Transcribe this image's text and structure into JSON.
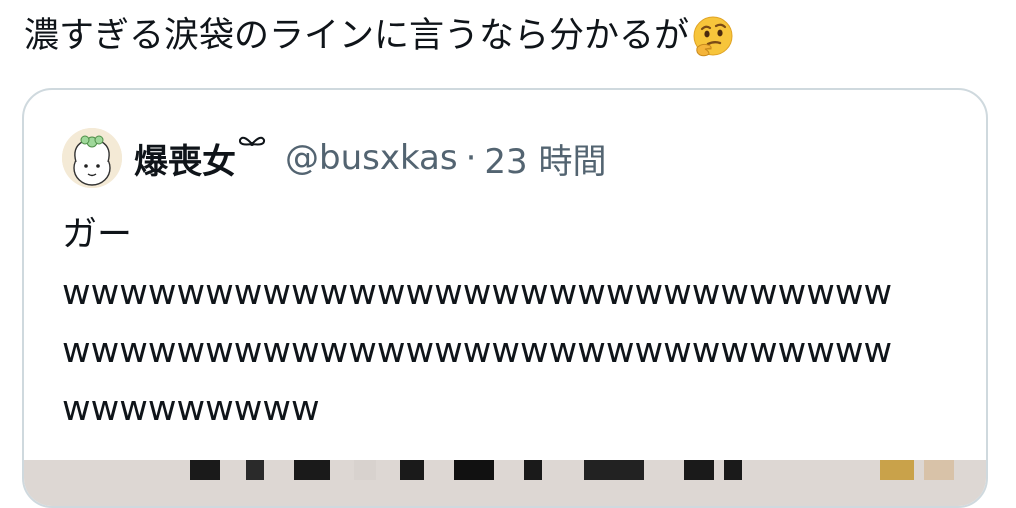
{
  "tweet": {
    "text": "濃すぎる涙袋のラインに言うなら分かるが",
    "emoji": "thinking-face"
  },
  "quote": {
    "display_name": "爆喪女",
    "handle": "@busxkas",
    "separator": "·",
    "time": "23 時間",
    "body_lines": [
      "ガー",
      "wwwwwwwwwwwwwwwwwwwwwwwwwwwww",
      "wwwwwwwwwwwwwwwwwwwwwwwwwwwww",
      "wwwwwwwww"
    ]
  },
  "colors": {
    "text": "#0f1419",
    "secondary": "#536471",
    "border": "#cfd9de"
  }
}
